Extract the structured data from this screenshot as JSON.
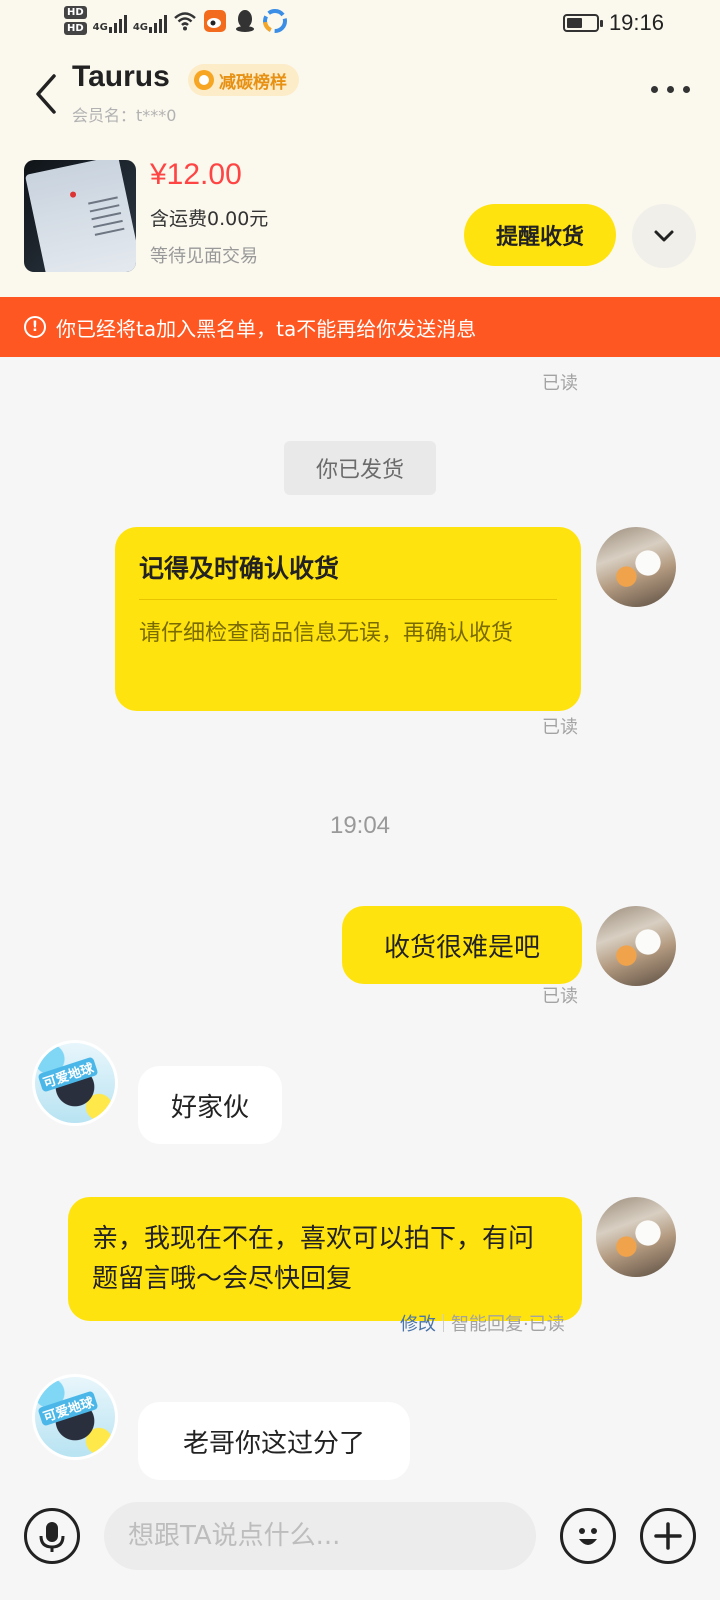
{
  "status_bar": {
    "hd1": "HD",
    "hd2": "HD",
    "net1": "4G",
    "net2": "4G",
    "time": "19:16",
    "battery_level": 0.55
  },
  "header": {
    "title": "Taurus",
    "badge_label": "减碳榜样",
    "member_label": "会员名：t***0"
  },
  "order": {
    "price": "¥12.00",
    "shipping": "含运费0.00元",
    "status": "等待见面交易",
    "remind_button": "提醒收货"
  },
  "banner": {
    "text": "你已经将ta加入黑名单，ta不能再给你发送消息"
  },
  "chat": {
    "read_label": "已读",
    "system_notice": "你已发货",
    "card": {
      "title": "记得及时确认收货",
      "body": "请仔细检查商品信息无误，再确认收货"
    },
    "timestamp": "19:04",
    "messages": [
      {
        "side": "right",
        "text": "收货很难是吧"
      },
      {
        "side": "left",
        "text": "好家伙"
      },
      {
        "side": "right",
        "text": "亲，我现在不在，喜欢可以拍下，有问题留言哦～会尽快回复"
      },
      {
        "side": "left",
        "text": "老哥你这过分了"
      }
    ],
    "auto_reply": {
      "edit": "修改",
      "meta": "智能回复·已读"
    },
    "avatar_tag": "可爱地球"
  },
  "input": {
    "placeholder": "想跟TA说点什么..."
  }
}
